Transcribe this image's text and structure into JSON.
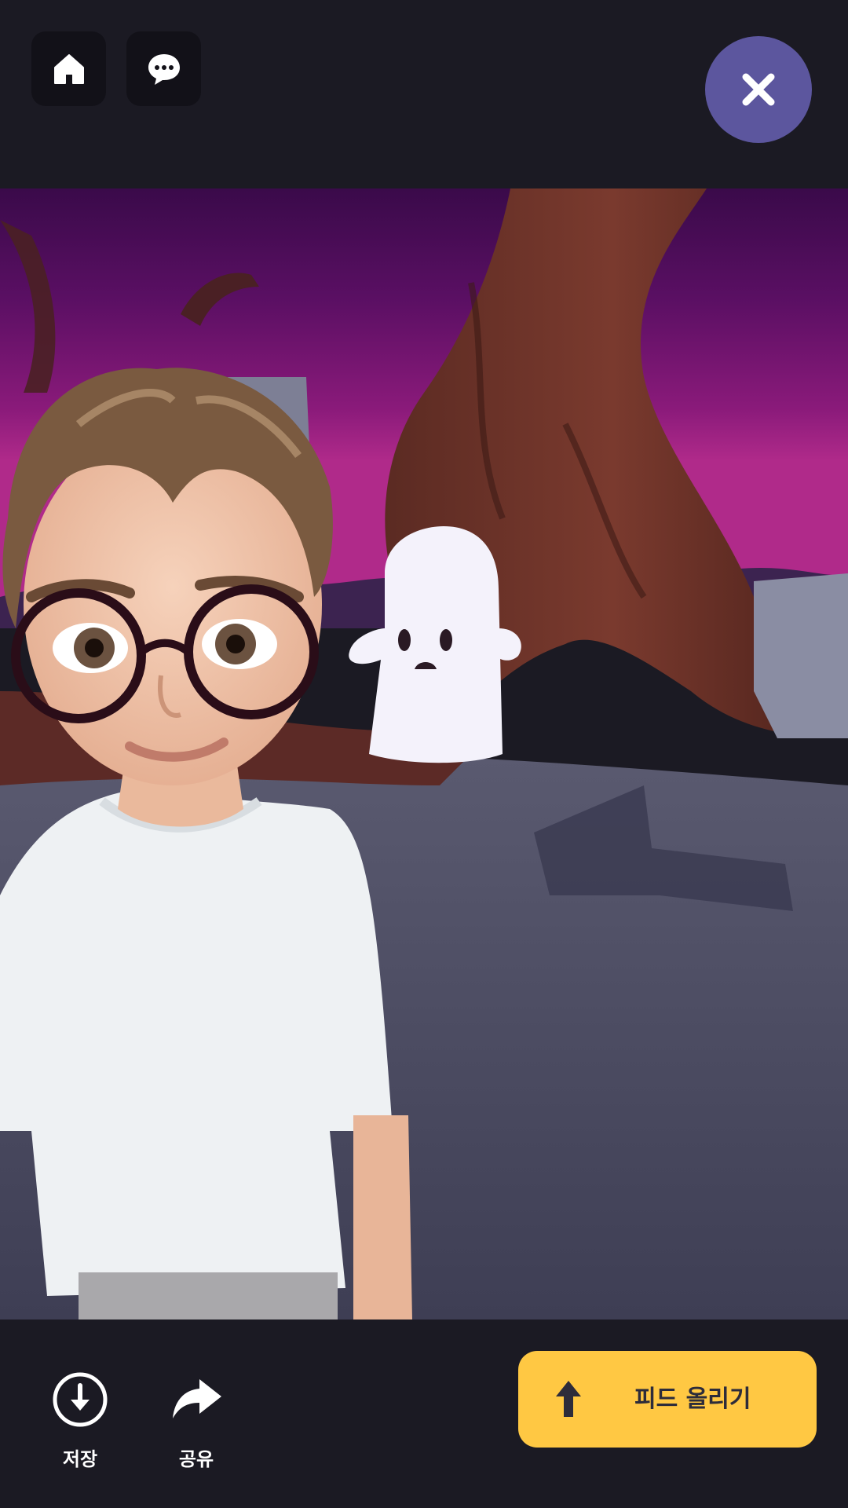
{
  "top_bar": {
    "home_icon": "home-icon",
    "chat_icon": "chat-bubble-icon",
    "close_icon": "close-icon",
    "close_color": "#5c569e"
  },
  "scene": {
    "description_icon": "avatar-photo",
    "sky_color": "#5a0f63",
    "ground_color": "#4a4a60"
  },
  "bottom_bar": {
    "save": {
      "label": "저장",
      "icon": "download-icon"
    },
    "share": {
      "label": "공유",
      "icon": "share-arrow-icon"
    },
    "post": {
      "label": "피드 올리기",
      "icon": "arrow-up-icon",
      "color": "#ffc843"
    }
  }
}
